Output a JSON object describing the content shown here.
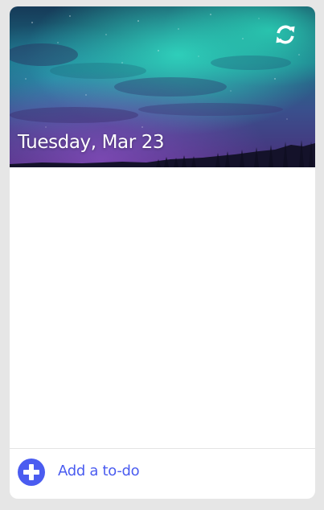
{
  "header": {
    "date": "Tuesday, Mar 23",
    "refresh_icon": "refresh-icon",
    "background_image": "aurora-night-sky"
  },
  "todos": [],
  "add_todo": {
    "label": "Add a to-do",
    "icon": "plus-circle-icon"
  },
  "colors": {
    "accent": "#4a5cf0",
    "page_background": "#e6e6e6",
    "card_background": "#ffffff",
    "divider": "#e4e4e4"
  }
}
